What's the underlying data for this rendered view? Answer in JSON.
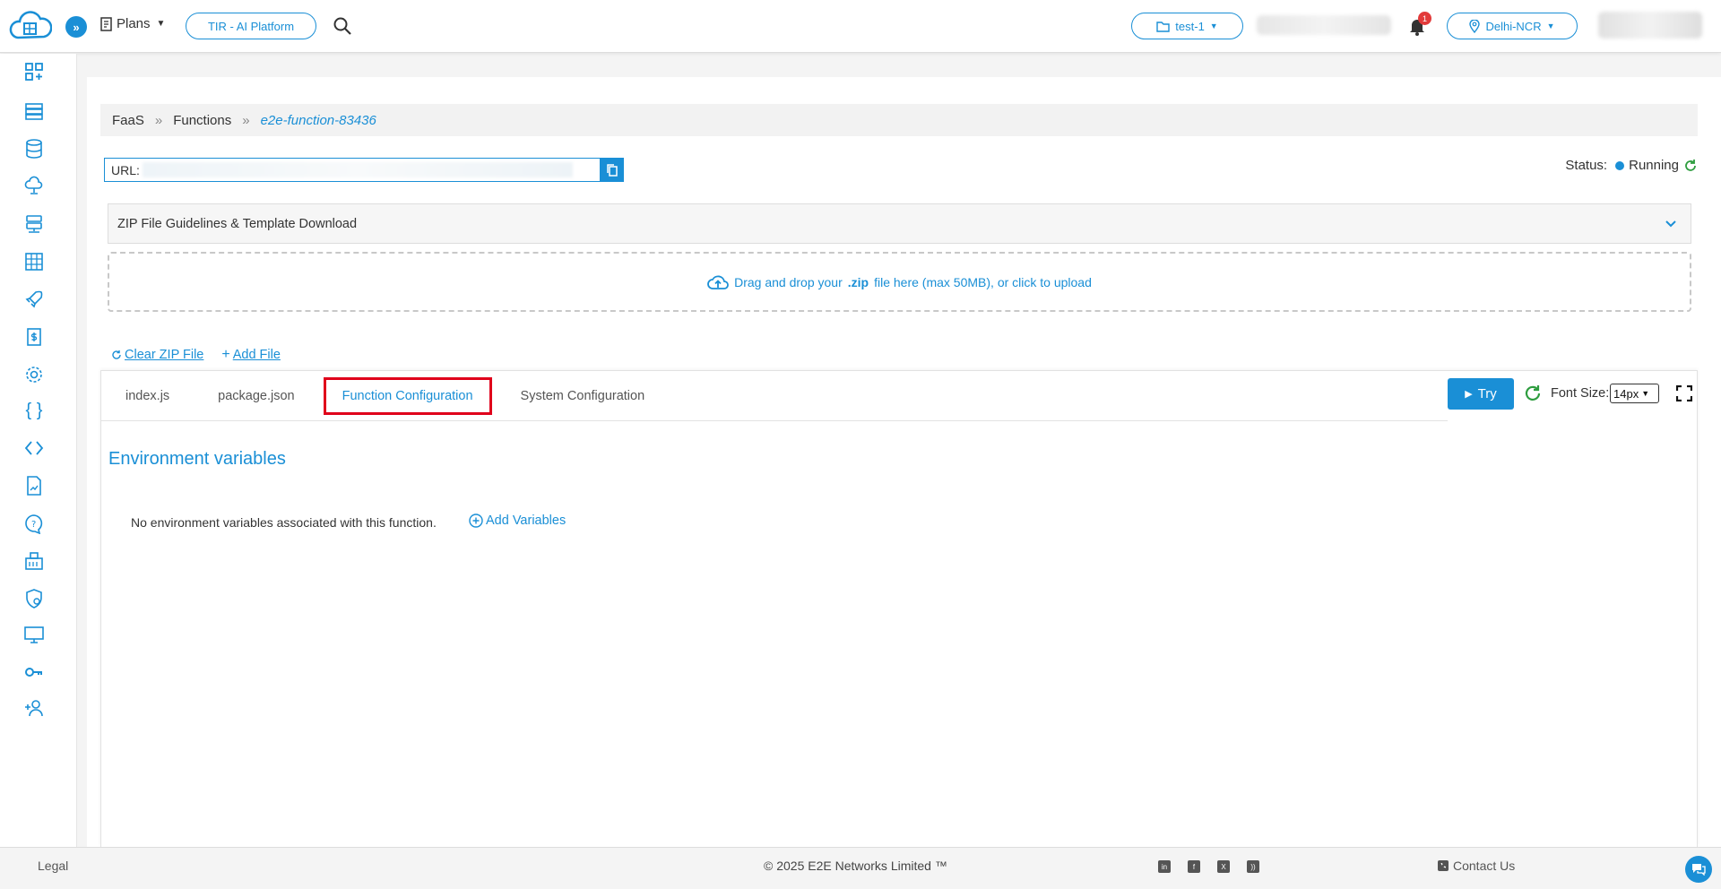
{
  "header": {
    "plans_label": "Plans",
    "platform_label": "TIR - AI Platform",
    "project_label": "test-1",
    "notifications_count": "1",
    "region_label": "Delhi-NCR"
  },
  "breadcrumb": {
    "items": [
      "FaaS",
      "Functions"
    ],
    "separator": "»",
    "current": "e2e-function-83436"
  },
  "url": {
    "label": "URL:"
  },
  "status": {
    "label": "Status:",
    "value": "Running",
    "color": "#1a8fd6"
  },
  "guidelines": {
    "label": "ZIP File Guidelines & Template Download"
  },
  "dropzone": {
    "prefix": "Drag and drop your",
    "ext": ".zip",
    "suffix": "file here (max 50MB), or click to upload"
  },
  "actions": {
    "clear_zip": "Clear ZIP File",
    "add_file": "Add File"
  },
  "editor": {
    "tabs": [
      "index.js",
      "package.json",
      "Function Configuration",
      "System Configuration"
    ],
    "active_tab": "Function Configuration",
    "try_label": "Try",
    "font_size_label": "Font Size:",
    "font_size_value": "14px"
  },
  "env": {
    "title": "Environment variables",
    "empty_message": "No environment variables associated with this function.",
    "add_label": "Add Variables"
  },
  "footer": {
    "legal": "Legal",
    "copyright": "© 2025 E2E Networks Limited ™",
    "contact": "Contact Us"
  },
  "colors": {
    "accent": "#1a8fd6",
    "highlight": "#e0001b",
    "alert": "#e23a3a",
    "refresh": "#2e9d3f"
  }
}
